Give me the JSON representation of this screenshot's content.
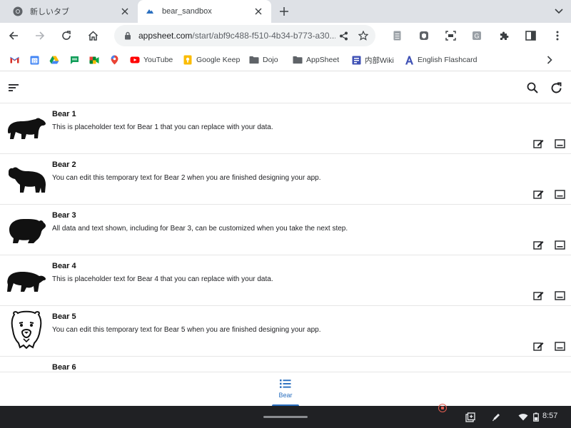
{
  "browser": {
    "tabs": [
      {
        "title": "新しいタブ",
        "active": false
      },
      {
        "title": "bear_sandbox",
        "active": true
      }
    ],
    "url_domain": "appsheet.com",
    "url_path": "/start/abf9c488-f510-4b34-b773-a30...",
    "bookmarks": [
      {
        "label": "",
        "icon": "gmail-icon"
      },
      {
        "label": "",
        "icon": "calendar-icon"
      },
      {
        "label": "",
        "icon": "drive-icon"
      },
      {
        "label": "",
        "icon": "chat-icon"
      },
      {
        "label": "",
        "icon": "meet-icon"
      },
      {
        "label": "",
        "icon": "maps-icon"
      },
      {
        "label": "YouTube",
        "icon": "youtube-icon"
      },
      {
        "label": "Google Keep",
        "icon": "keep-icon"
      },
      {
        "label": "Dojo",
        "icon": "folder-icon"
      },
      {
        "label": "AppSheet",
        "icon": "folder-icon"
      },
      {
        "label": "内部Wiki",
        "icon": "wiki-icon"
      },
      {
        "label": "English Flashcard",
        "icon": "flashcard-icon"
      }
    ]
  },
  "app": {
    "rows": [
      {
        "title": "Bear 1",
        "description": "This is placeholder text for Bear 1 that you can replace with your data.",
        "icon": "bear-walking-icon"
      },
      {
        "title": "Bear 2",
        "description": "You can edit this temporary text for Bear 2 when you are finished designing your app.",
        "icon": "bear-standing-icon"
      },
      {
        "title": "Bear 3",
        "description": "All data and text shown, including for Bear 3, can be customized when you take the next step.",
        "icon": "bear-side-icon"
      },
      {
        "title": "Bear 4",
        "description": "This is placeholder text for Bear 4 that you can replace with your data.",
        "icon": "bear-polar-icon"
      },
      {
        "title": "Bear 5",
        "description": "You can edit this temporary text for Bear 5 when you are finished designing your app.",
        "icon": "bear-face-icon"
      },
      {
        "title": "Bear 6",
        "description": "",
        "icon": "bear-partial-icon"
      }
    ],
    "nav": {
      "label": "Bear",
      "icon": "list-icon"
    }
  },
  "os": {
    "time": "8:57"
  },
  "colors": {
    "accent": "#2a6fbf",
    "tabstrip": "#dee1e6",
    "shelf": "#202124"
  }
}
